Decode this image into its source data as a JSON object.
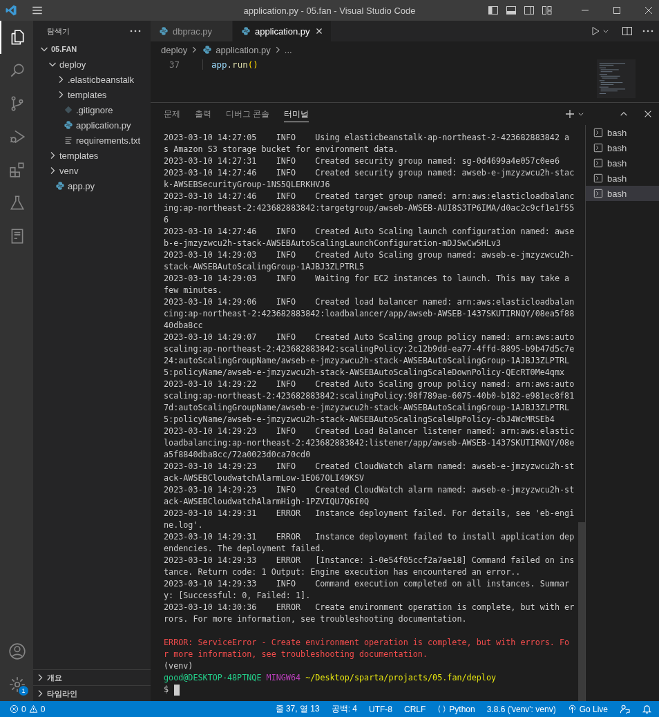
{
  "window": {
    "title": "application.py - 05.fan - Visual Studio Code"
  },
  "activity_bar": {
    "items": [
      {
        "kind": "files",
        "selected": true
      },
      {
        "kind": "search",
        "selected": false
      },
      {
        "kind": "source-control",
        "selected": false
      },
      {
        "kind": "run",
        "selected": false
      },
      {
        "kind": "extensions",
        "selected": false
      },
      {
        "kind": "flask",
        "selected": false
      },
      {
        "kind": "book",
        "selected": false
      }
    ],
    "bottom": [
      {
        "kind": "account"
      },
      {
        "kind": "settings",
        "badge": "1"
      }
    ]
  },
  "sidebar": {
    "title": "탐색기",
    "tree": [
      {
        "label": "05.FAN",
        "kind": "root",
        "expanded": true,
        "children": [
          {
            "label": "deploy",
            "kind": "folder",
            "expanded": true,
            "children": [
              {
                "label": ".elasticbeanstalk",
                "kind": "folder",
                "expanded": false
              },
              {
                "label": "templates",
                "kind": "folder",
                "expanded": false
              },
              {
                "label": ".gitignore",
                "kind": "git"
              },
              {
                "label": "application.py",
                "kind": "python"
              },
              {
                "label": "requirements.txt",
                "kind": "text"
              }
            ]
          },
          {
            "label": "templates",
            "kind": "folder",
            "expanded": false
          },
          {
            "label": "venv",
            "kind": "folder",
            "expanded": false
          },
          {
            "label": "app.py",
            "kind": "python"
          }
        ]
      }
    ],
    "sections": [
      {
        "label": "개요",
        "expanded": false
      },
      {
        "label": "타임라인",
        "expanded": false
      }
    ]
  },
  "editor": {
    "tabs": [
      {
        "label": "dbprac.py",
        "selected": false
      },
      {
        "label": "application.py",
        "selected": true
      }
    ],
    "breadcrumb": [
      {
        "label": "deploy",
        "kind": "folder"
      },
      {
        "label": "application.py",
        "kind": "python"
      },
      {
        "label": "...",
        "kind": "more"
      }
    ],
    "lines": [
      {
        "number": "37",
        "tokens": [
          {
            "text": "app",
            "kind": "variable"
          },
          {
            "text": ".",
            "kind": "plain"
          },
          {
            "text": "run",
            "kind": "function"
          },
          {
            "text": "()",
            "kind": "bracket"
          }
        ]
      }
    ]
  },
  "panel": {
    "tabs": [
      {
        "label": "문제",
        "selected": false
      },
      {
        "label": "출력",
        "selected": false
      },
      {
        "label": "디버그 콘솔",
        "selected": false
      },
      {
        "label": "터미널",
        "selected": true
      }
    ],
    "terminal": {
      "log": [
        {
          "time": "2023-03-10 14:27:05",
          "level": "INFO",
          "message": "Using elasticbeanstalk-ap-northeast-2-423682883842 as Amazon S3 storage bucket for environment data."
        },
        {
          "time": "2023-03-10 14:27:31",
          "level": "INFO",
          "message": "Created security group named: sg-0d4699a4e057c0ee6"
        },
        {
          "time": "2023-03-10 14:27:46",
          "level": "INFO",
          "message": "Created security group named: awseb-e-jmzyzwcu2h-stack-AWSEBSecurityGroup-1NS5QLERKHVJ6"
        },
        {
          "time": "2023-03-10 14:27:46",
          "level": "INFO",
          "message": "Created target group named: arn:aws:elasticloadbalancing:ap-northeast-2:423682883842:targetgroup/awseb-AWSEB-AUI8S3TP6IMA/d0ac2c9cf1e1f556"
        },
        {
          "time": "2023-03-10 14:27:46",
          "level": "INFO",
          "message": "Created Auto Scaling launch configuration named: awseb-e-jmzyzwcu2h-stack-AWSEBAutoScalingLaunchConfiguration-mDJSwCw5HLv3"
        },
        {
          "time": "2023-03-10 14:29:03",
          "level": "INFO",
          "message": "Created Auto Scaling group named: awseb-e-jmzyzwcu2h-stack-AWSEBAutoScalingGroup-1AJBJ3ZLPTRL5"
        },
        {
          "time": "2023-03-10 14:29:03",
          "level": "INFO",
          "message": "Waiting for EC2 instances to launch. This may take a few minutes."
        },
        {
          "time": "2023-03-10 14:29:06",
          "level": "INFO",
          "message": "Created load balancer named: arn:aws:elasticloadbalancing:ap-northeast-2:423682883842:loadbalancer/app/awseb-AWSEB-1437SKUTIRNQY/08ea5f8840dba8cc"
        },
        {
          "time": "2023-03-10 14:29:07",
          "level": "INFO",
          "message": "Created Auto Scaling group policy named: arn:aws:autoscaling:ap-northeast-2:423682883842:scalingPolicy:2c12b9dd-ea77-4ffd-8895-b9b47d5c7e24:autoScalingGroupName/awseb-e-jmzyzwcu2h-stack-AWSEBAutoScalingGroup-1AJBJ3ZLPTRL5:policyName/awseb-e-jmzyzwcu2h-stack-AWSEBAutoScalingScaleDownPolicy-QEcRT0Me4qmx"
        },
        {
          "time": "2023-03-10 14:29:22",
          "level": "INFO",
          "message": "Created Auto Scaling group policy named: arn:aws:autoscaling:ap-northeast-2:423682883842:scalingPolicy:98f789ae-6075-40b0-b182-e981ec8f817d:autoScalingGroupName/awseb-e-jmzyzwcu2h-stack-AWSEBAutoScalingGroup-1AJBJ3ZLPTRL5:policyName/awseb-e-jmzyzwcu2h-stack-AWSEBAutoScalingScaleUpPolicy-cbJ4WcMRSEb4"
        },
        {
          "time": "2023-03-10 14:29:23",
          "level": "INFO",
          "message": "Created Load Balancer listener named: arn:aws:elasticloadbalancing:ap-northeast-2:423682883842:listener/app/awseb-AWSEB-1437SKUTIRNQY/08ea5f8840dba8cc/72a0023d0ca70cd0"
        },
        {
          "time": "2023-03-10 14:29:23",
          "level": "INFO",
          "message": "Created CloudWatch alarm named: awseb-e-jmzyzwcu2h-stack-AWSEBCloudwatchAlarmLow-1EO67OLI49KSV"
        },
        {
          "time": "2023-03-10 14:29:23",
          "level": "INFO",
          "message": "Created CloudWatch alarm named: awseb-e-jmzyzwcu2h-stack-AWSEBCloudwatchAlarmHigh-1PZVIQU7Q6I0Q"
        },
        {
          "time": "2023-03-10 14:29:31",
          "level": "ERROR",
          "message": "Instance deployment failed. For details, see 'eb-engine.log'."
        },
        {
          "time": "2023-03-10 14:29:31",
          "level": "ERROR",
          "message": "Instance deployment failed to install application dependencies. The deployment failed."
        },
        {
          "time": "2023-03-10 14:29:33",
          "level": "ERROR",
          "message": "[Instance: i-0e54f05ccf2a7ae18] Command failed on instance. Return code: 1 Output: Engine execution has encountered an error.."
        },
        {
          "time": "2023-03-10 14:29:33",
          "level": "INFO",
          "message": "Command execution completed on all instances. Summary: [Successful: 0, Failed: 1]."
        },
        {
          "time": "2023-03-10 14:30:36",
          "level": "ERROR",
          "message": "Create environment operation is complete, but with errors. For more information, see troubleshooting documentation."
        }
      ],
      "error": "ERROR: ServiceError - Create environment operation is complete, but with errors. For more information, see troubleshooting documentation.",
      "venv": "(venv)",
      "prompt": {
        "user": "good@DESKTOP-48PTNQE",
        "system": "MINGW64",
        "path": "~/Desktop/sparta/projacts/05.fan/deploy"
      },
      "input": "$"
    },
    "terminals": [
      {
        "label": "bash",
        "selected": false
      },
      {
        "label": "bash",
        "selected": false
      },
      {
        "label": "bash",
        "selected": false
      },
      {
        "label": "bash",
        "selected": false
      },
      {
        "label": "bash",
        "selected": true
      }
    ]
  },
  "status_bar": {
    "errors": "0",
    "warnings": "0",
    "items": [
      {
        "kind": "text",
        "label": "줄 37, 열 13"
      },
      {
        "kind": "text",
        "label": "공백: 4"
      },
      {
        "kind": "text",
        "label": "UTF-8"
      },
      {
        "kind": "text",
        "label": "CRLF"
      },
      {
        "kind": "language",
        "label": "Python"
      },
      {
        "kind": "text",
        "label": "3.8.6 ('venv': venv)"
      },
      {
        "kind": "live",
        "label": "Go Live"
      },
      {
        "kind": "feedback"
      },
      {
        "kind": "bell"
      }
    ]
  }
}
